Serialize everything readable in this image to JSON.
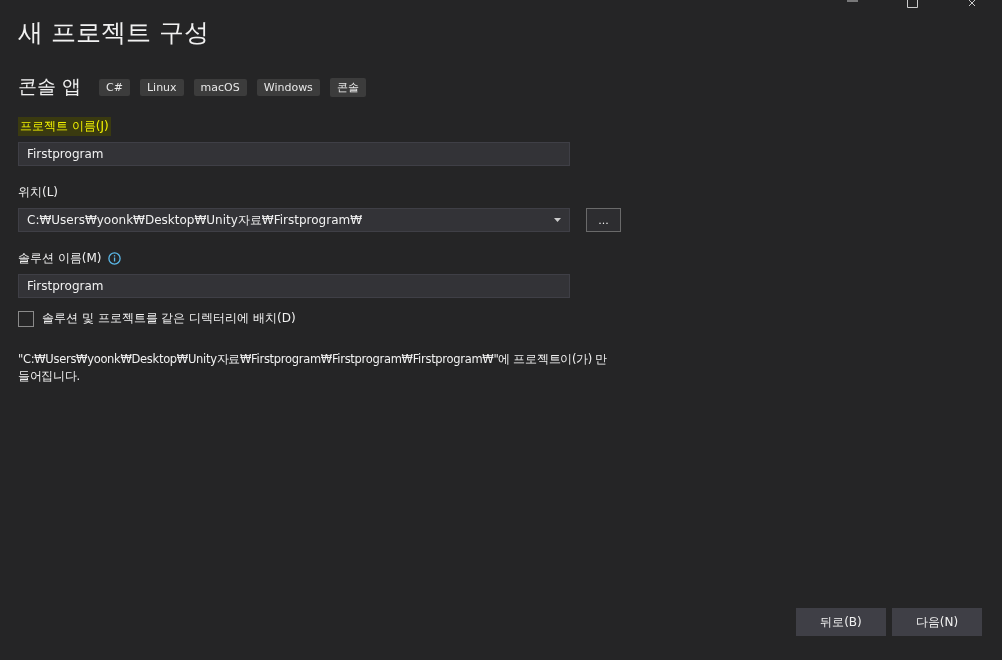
{
  "window": {
    "title": "새 프로젝트 구성"
  },
  "template": {
    "name": "콘솔 앱",
    "tags": [
      "C#",
      "Linux",
      "macOS",
      "Windows",
      "콘솔"
    ]
  },
  "fields": [
    {
      "kind": "text",
      "label": "프로젝트 이름(J)",
      "highlighted": true,
      "value": "Firstprogram"
    },
    {
      "kind": "combo",
      "label": "위치(L)",
      "highlighted": false,
      "value": "C:₩Users₩yoonk₩Desktop₩Unity자료₩Firstprogram₩",
      "browse": "..."
    },
    {
      "kind": "text",
      "label": "솔루션 이름(M)",
      "highlighted": false,
      "info": true,
      "value": "Firstprogram"
    }
  ],
  "same_directory": {
    "label": "솔루션 및 프로젝트를 같은 디렉터리에 배치(D)",
    "checked": false
  },
  "summary": "\"C:₩Users₩yoonk₩Desktop₩Unity자료₩Firstprogram₩Firstprogram₩Firstprogram₩\"에 프로젝트이(가) 만들어집니다.",
  "buttons": [
    "뒤로(B)",
    "다음(N)"
  ]
}
